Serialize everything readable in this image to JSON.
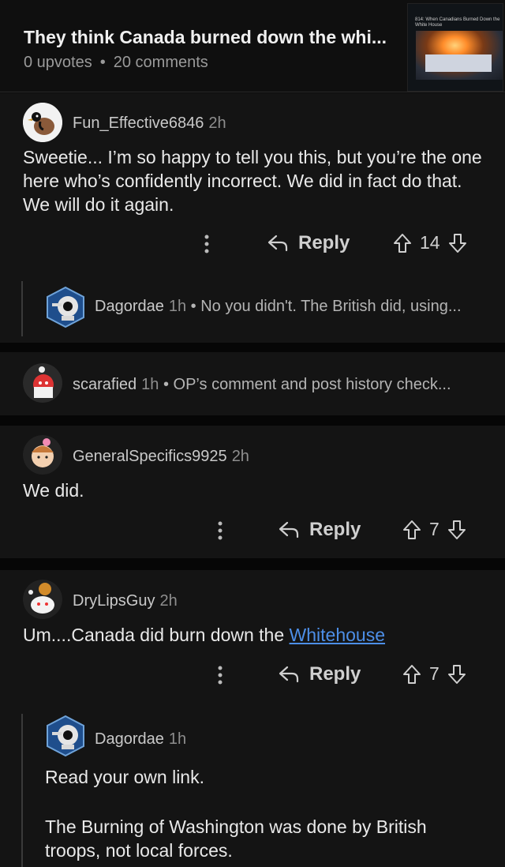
{
  "post": {
    "title": "They think Canada burned down the whi...",
    "upvotes": "0 upvotes",
    "comments": "20 comments",
    "thumbnail_title": "814: When Canadians Burned Down the White House"
  },
  "comments": [
    {
      "username": "Fun_Effective6846",
      "age": "2h",
      "body": "Sweetie... I’m so happy to tell you this, but you’re the one here who’s confidently incorrect. We did in fact do that. We will do it again.",
      "reply": "Reply",
      "votes": "14"
    },
    {
      "username": "Dagordae",
      "age": "1h",
      "preview": "No you didn't. The British did, using..."
    },
    {
      "username": "scarafied",
      "age": "1h",
      "preview": "OP’s comment and post history check..."
    },
    {
      "username": "GeneralSpecifics9925",
      "age": "2h",
      "body": "We did.",
      "reply": "Reply",
      "votes": "7"
    },
    {
      "username": "DryLipsGuy",
      "age": "2h",
      "body_prefix": "Um....Canada did burn down the ",
      "link": "Whitehouse ",
      "reply": "Reply",
      "votes": "7"
    },
    {
      "username": "Dagordae",
      "age": "1h",
      "body1": "Read your own link.",
      "body2": "The Burning of Washington was done by British troops, not local forces."
    }
  ],
  "colors": {
    "background": "#141414",
    "link": "#4d8fe8",
    "separator": "#060606"
  },
  "icons": [
    "more-vertical-icon",
    "reply-arrow-icon",
    "upvote-arrow-icon",
    "downvote-arrow-icon"
  ]
}
